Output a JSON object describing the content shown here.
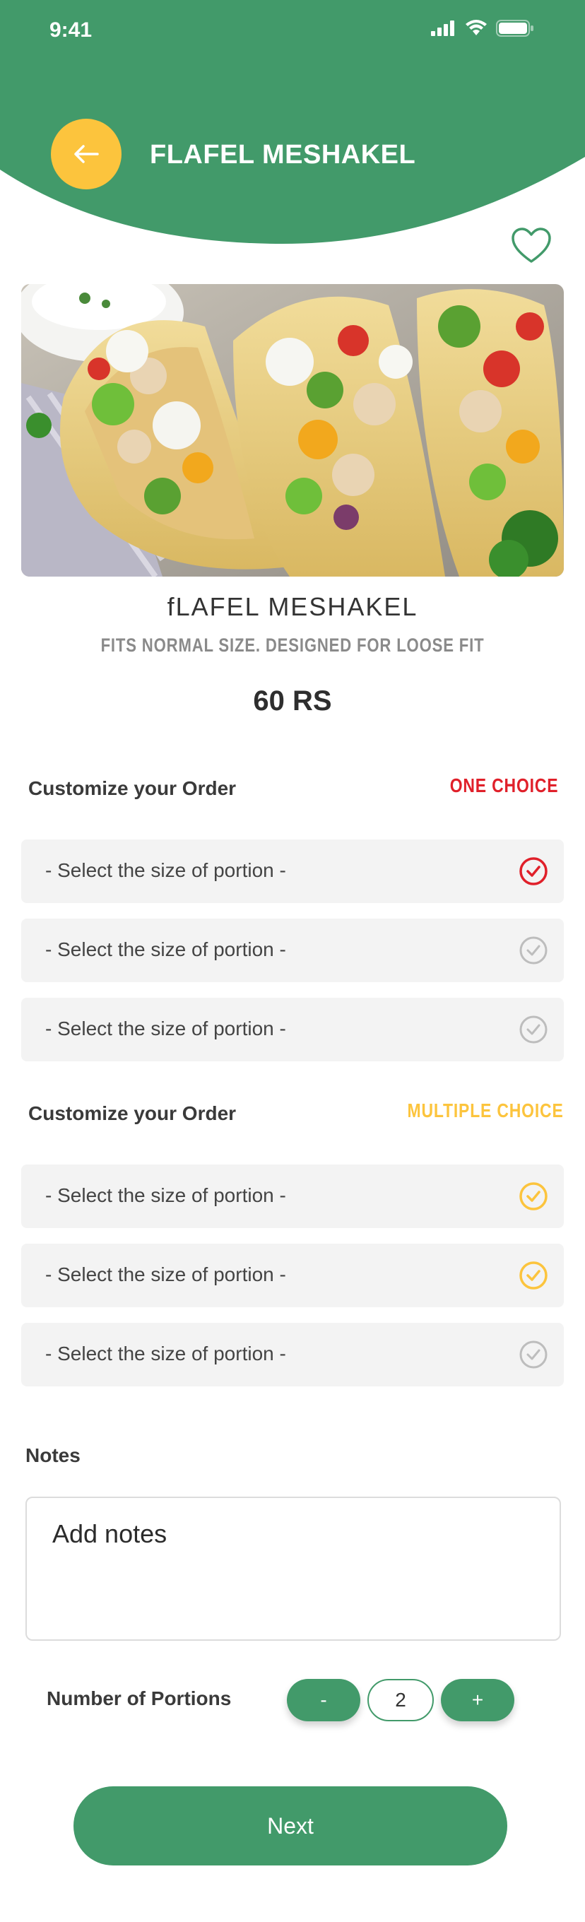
{
  "status_bar": {
    "time": "9:41",
    "icons": [
      "signal-icon",
      "wifi-icon",
      "battery-icon"
    ]
  },
  "header": {
    "title": "FLAFEL MESHAKEL",
    "back_icon": "arrow-left-icon",
    "favorite_icon": "heart-outline-icon"
  },
  "colors": {
    "brand_green": "#429a6a",
    "accent_yellow": "#fcc43d",
    "selected_red": "#e0202a",
    "inactive_gray": "#bdbdbd"
  },
  "product": {
    "name": "fLAFEL  MESHAKEL",
    "subtitle": "FITS NORMAL SIZE. DESIGNED FOR LOOSE FIT",
    "price": "60 RS"
  },
  "customize_one": {
    "title": "Customize your Order",
    "tag": "ONE CHOICE",
    "options": [
      {
        "label": "- Select the size of portion -",
        "state": "selected"
      },
      {
        "label": "- Select the size of portion -",
        "state": "unselected"
      },
      {
        "label": "- Select the size of portion -",
        "state": "unselected"
      }
    ]
  },
  "customize_multiple": {
    "title": "Customize your Order",
    "tag": "MULTIPLE CHOICE",
    "options": [
      {
        "label": "- Select the size of portion -",
        "state": "selected"
      },
      {
        "label": "- Select the size of portion -",
        "state": "selected"
      },
      {
        "label": "- Select the size of portion -",
        "state": "unselected"
      }
    ]
  },
  "notes": {
    "title": "Notes",
    "placeholder": "Add notes"
  },
  "portions": {
    "label": "Number of Portions",
    "minus_label": "-",
    "value": "2",
    "plus_label": "+"
  },
  "next_button": {
    "label": "Next"
  }
}
